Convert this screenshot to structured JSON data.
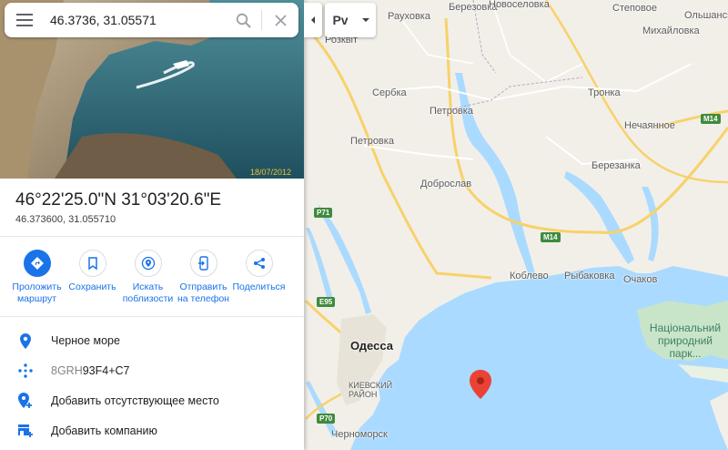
{
  "search": {
    "query": "46.3736, 31.05571",
    "menu_icon": "menu-icon",
    "search_icon": "search-icon",
    "clear_icon": "close-icon"
  },
  "layer_control": {
    "label": "Рv"
  },
  "place": {
    "photo_date": "18/07/2012",
    "title": "46°22'25.0\"N 31°03'20.6\"E",
    "decimal": "46.373600, 31.055710"
  },
  "actions": [
    {
      "label": "Проложить маршрут",
      "icon": "directions-icon"
    },
    {
      "label": "Сохранить",
      "icon": "bookmark-icon"
    },
    {
      "label": "Искать поблизости",
      "icon": "nearby-icon"
    },
    {
      "label": "Отправить на телефон",
      "icon": "send-to-phone-icon"
    },
    {
      "label": "Поделиться",
      "icon": "share-icon"
    }
  ],
  "info": {
    "location": "Черное море",
    "plus_code_prefix": "8GRH",
    "plus_code_rest": "93F4+C7",
    "add_place": "Добавить отсутствующее место",
    "add_business": "Добавить компанию"
  },
  "map": {
    "labels": {
      "raukhovka": "Рауховка",
      "berezovka": "Березовка",
      "novoselovka": "Новоселовка",
      "stepovoe": "Степовое",
      "olshanskoe": "Ольшанское",
      "mikhaylovka": "Михайловка",
      "rozkvit": "Розквіт",
      "serbka": "Сербка",
      "petrovka1": "Петровка",
      "petrovka2": "Петровка",
      "tronka": "Тронка",
      "nechayannoe": "Нечаянное",
      "dobroslav": "Доброслав",
      "berezanka": "Березанка",
      "koblevo": "Коблево",
      "rybakovka": "Рыбаковка",
      "ochakov": "Очаков",
      "odessa": "Одесса",
      "kievsky": "КИЕВСКИЙ РАЙОН",
      "chernomorsk": "Черноморск",
      "park": "Національний природний парк..."
    },
    "roads": {
      "p71": "P71",
      "m14a": "M14",
      "m14b": "M14",
      "e95": "E95",
      "p70": "P70"
    },
    "colors": {
      "land": "#f2efe9",
      "water": "#aadaff",
      "road_major": "#f7d26a",
      "road_minor": "#ffffff",
      "pin": "#ea4335",
      "accent": "#1a73e8"
    }
  }
}
